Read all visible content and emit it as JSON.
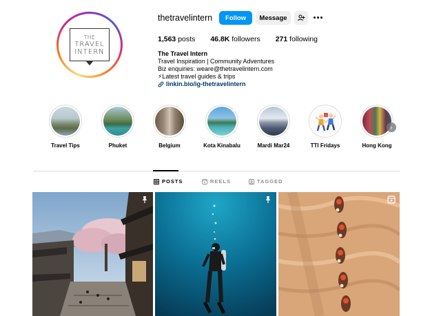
{
  "profile": {
    "username": "thetravelintern",
    "follow_label": "Follow",
    "message_label": "Message",
    "add_user_icon": "add-user-icon",
    "more_icon": "more-options-icon",
    "avatar_logo": {
      "line1": "THE",
      "line2": "TRAVEL",
      "line3": "INTERN"
    }
  },
  "stats": {
    "posts_count": "1,563",
    "posts_label": "posts",
    "followers_count": "46.8K",
    "followers_label": "followers",
    "following_count": "271",
    "following_label": "following"
  },
  "bio": {
    "name": "The Travel Intern",
    "line1": "Travel Inspiration | Community Adventures",
    "line2": "Biz enquiries: weare@thetravelintern.com",
    "line3": "⚡Latest travel guides & trips",
    "link": "linkin.bio/ig-thetravelintern"
  },
  "highlights": [
    {
      "label": "Travel Tips"
    },
    {
      "label": "Phuket"
    },
    {
      "label": "Belgium"
    },
    {
      "label": "Kota Kinabalu"
    },
    {
      "label": "Mardi Mar24"
    },
    {
      "label": "TTI Fridays"
    },
    {
      "label": "Hong Kong"
    }
  ],
  "tabs": [
    {
      "label": "POSTS",
      "icon": "grid-icon",
      "active": true
    },
    {
      "label": "REELS",
      "icon": "reels-icon",
      "active": false
    },
    {
      "label": "TAGGED",
      "icon": "tagged-icon",
      "active": false
    }
  ],
  "colors": {
    "follow_blue": "#0095f6",
    "link_blue": "#00376b"
  }
}
